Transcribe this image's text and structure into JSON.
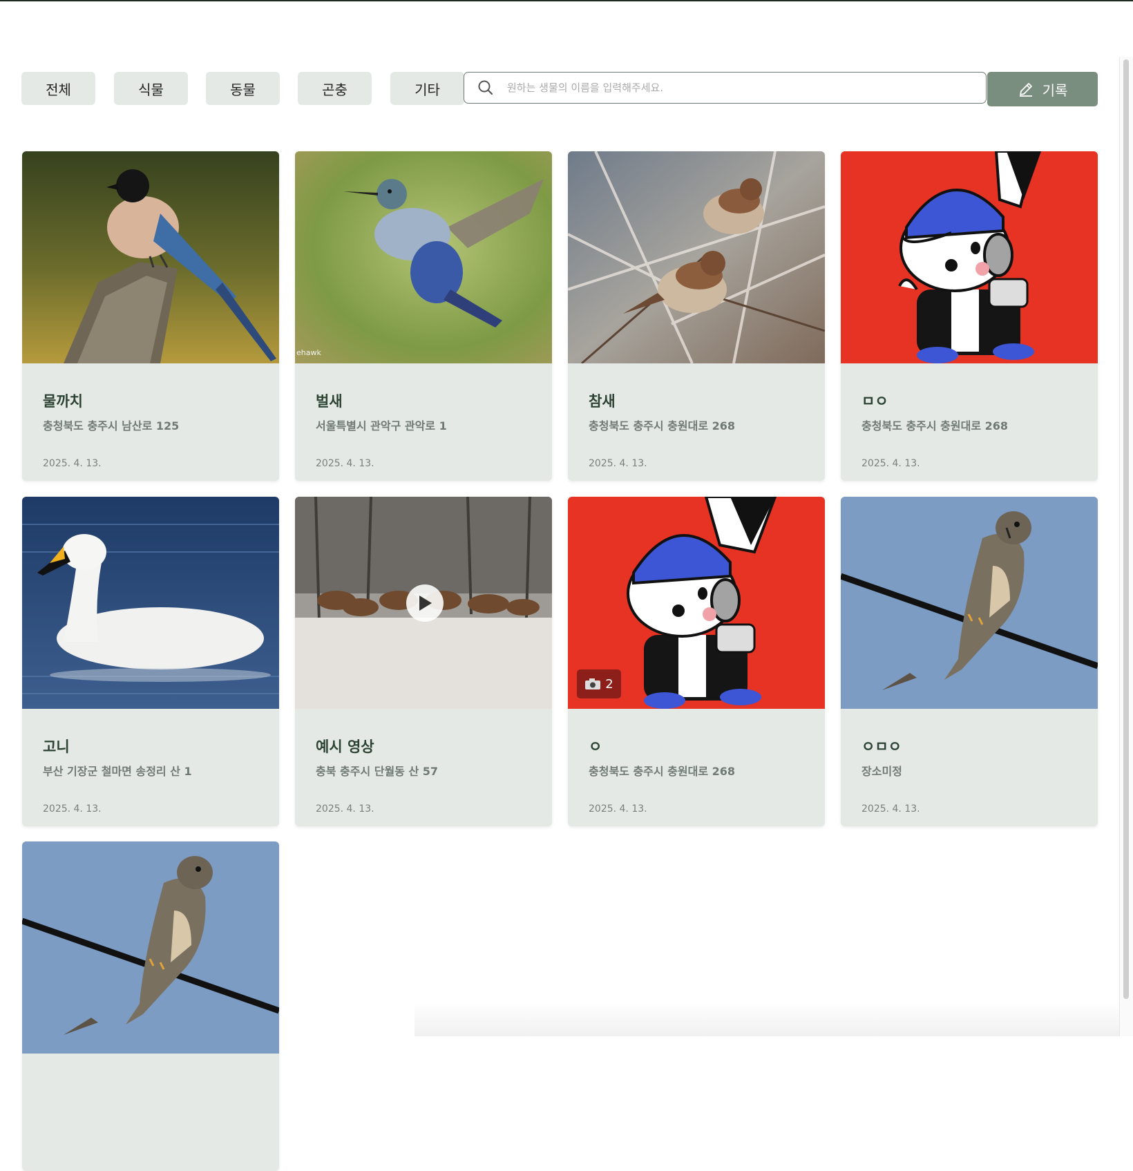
{
  "filters": [
    {
      "label": "전체"
    },
    {
      "label": "식물"
    },
    {
      "label": "동물"
    },
    {
      "label": "곤충"
    },
    {
      "label": "기타"
    }
  ],
  "search": {
    "placeholder": "원하는 생물의 이름을 입력해주세요.",
    "value": ""
  },
  "record_button": {
    "label": "기록",
    "icon": "pencil-icon"
  },
  "cards": [
    {
      "name": "물까치",
      "location": "충청북도 충주시 남산로 125",
      "date": "2025. 4. 13.",
      "image": "azure-winged-magpie"
    },
    {
      "name": "벌새",
      "location": "서울특별시 관악구 관악로 1",
      "date": "2025. 4. 13.",
      "image": "hummingbird",
      "watermark": "ehawk"
    },
    {
      "name": "참새",
      "location": "충청북도 충주시 충원대로 268",
      "date": "2025. 4. 13.",
      "image": "sparrows"
    },
    {
      "name": "ㅁㅇ",
      "location": "충청북도 충주시 충원대로 268",
      "date": "2025. 4. 13.",
      "image": "rabbit-cartoon"
    },
    {
      "name": "고니",
      "location": "부산 기장군 철마면 송정리 산 1",
      "date": "2025. 4. 13.",
      "image": "swan"
    },
    {
      "name": "예시 영상",
      "location": "충북 충주시 단월동 산 57",
      "date": "2025. 4. 13.",
      "image": "deer-snow",
      "video": true
    },
    {
      "name": "ㅇ",
      "location": "충청북도 충주시 충원대로 268",
      "date": "2025. 4. 13.",
      "image": "rabbit-cartoon",
      "photo_count": "2"
    },
    {
      "name": "ㅇㅁㅇ",
      "location": "장소미정",
      "date": "2025. 4. 13.",
      "image": "falcon"
    },
    {
      "name": "",
      "location": "",
      "date": "",
      "image": "falcon"
    }
  ],
  "colors": {
    "filter_bg": "#e4e9e5",
    "card_bg": "#e4e9e5",
    "accent": "#7a8e80",
    "title": "#2c4232",
    "photo_badge": "#8d1f1a"
  }
}
